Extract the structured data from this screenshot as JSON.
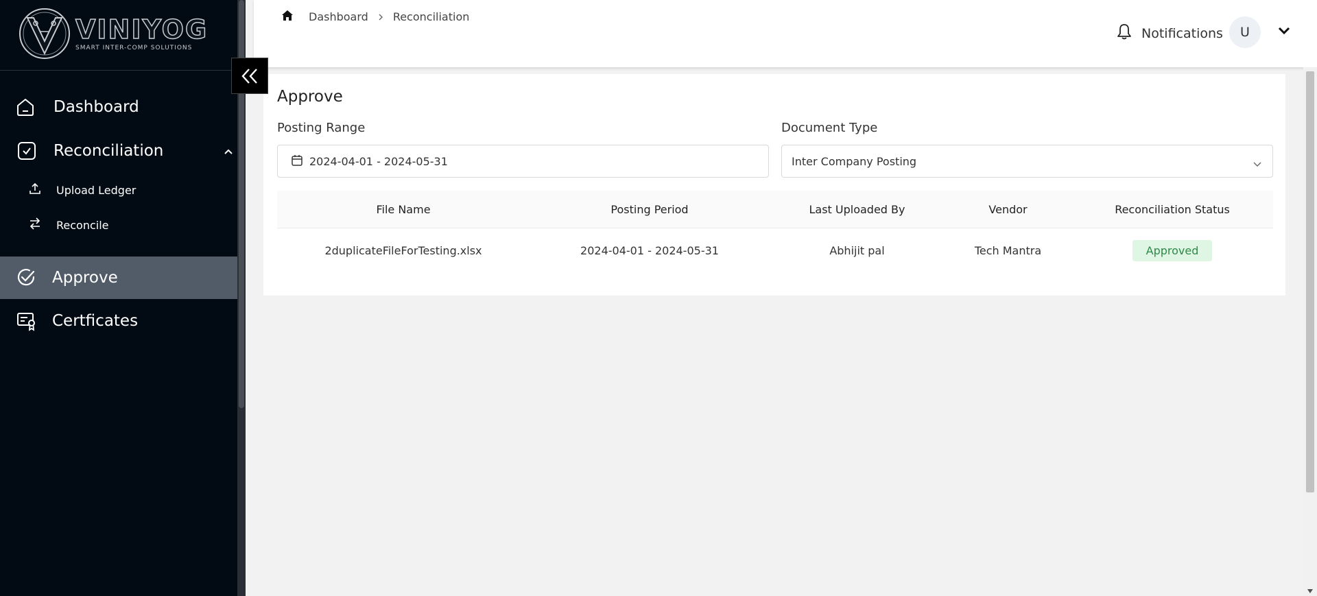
{
  "brand": {
    "name": "VINIYOG",
    "tagline": "SMART INTER-COMP SOLUTIONS"
  },
  "sidebar": {
    "items": [
      {
        "label": "Dashboard"
      },
      {
        "label": "Reconciliation"
      },
      {
        "label": "Upload Ledger"
      },
      {
        "label": "Reconcile"
      },
      {
        "label": "Approve"
      },
      {
        "label": "Certficates"
      }
    ]
  },
  "header": {
    "breadcrumb": [
      "Dashboard",
      "Reconciliation"
    ],
    "notifications_label": "Notifications",
    "avatar_initial": "U"
  },
  "card": {
    "title": "Approve",
    "posting_range_label": "Posting Range",
    "posting_range_value": "2024-04-01 - 2024-05-31",
    "document_type_label": "Document Type",
    "document_type_value": "Inter Company Posting"
  },
  "table": {
    "columns": [
      "File Name",
      "Posting Period",
      "Last Uploaded By",
      "Vendor",
      "Reconciliation Status"
    ],
    "rows": [
      [
        "2duplicateFileForTesting.xlsx",
        "2024-04-01 - 2024-05-31",
        "Abhijit pal",
        "Tech Mantra",
        "Approved"
      ]
    ]
  },
  "colors": {
    "sidebar_bg": "#020b13",
    "active_bg": "#525c68",
    "badge_bg": "#dff6e5",
    "badge_text": "#2c8a46"
  }
}
